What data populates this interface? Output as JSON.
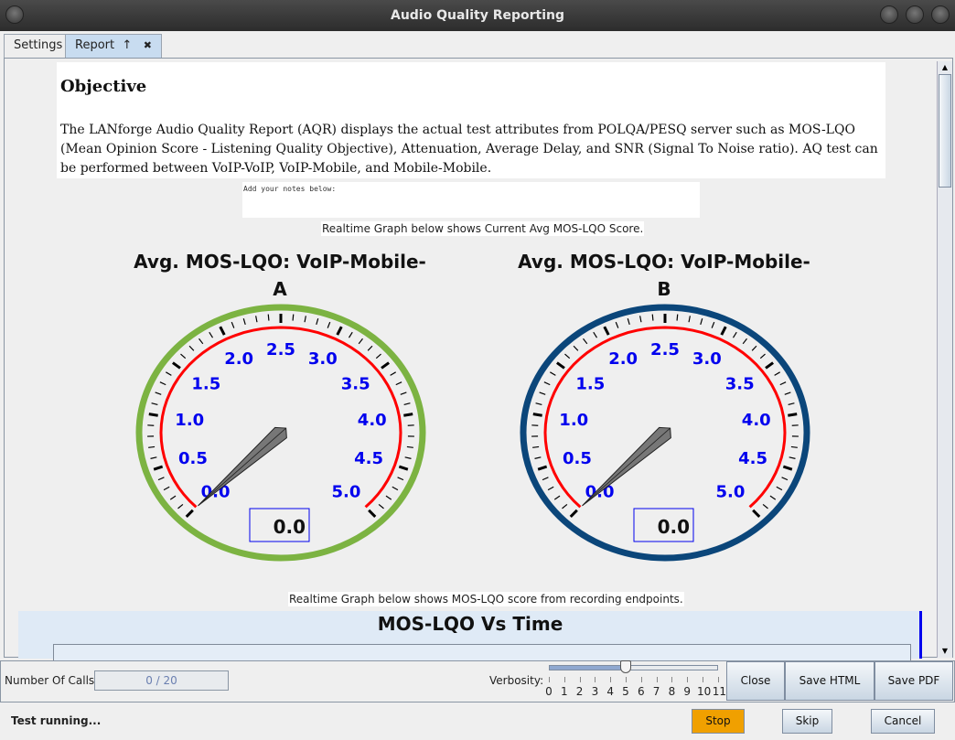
{
  "window": {
    "title": "Audio Quality Reporting"
  },
  "tabs": [
    {
      "label": "Settings"
    },
    {
      "label": "Report",
      "pin": "↑",
      "close": "✖"
    }
  ],
  "objective": {
    "heading": "Objective",
    "text": "The LANforge Audio Quality Report (AQR) displays the actual test attributes from POLQA/PESQ server such as MOS-LQO (Mean Opinion Score - Listening Quality Objective), Attenuation, Average Delay, and SNR (Signal To Noise ratio). AQ test can be performed between VoIP-VoIP, VoIP-Mobile, and Mobile-Mobile."
  },
  "notes": {
    "placeholder": "Add your notes below:"
  },
  "caption1": "Realtime Graph below shows Current Avg MOS-LQO Score.",
  "gauges": [
    {
      "title1": "Avg. MOS-LQO: VoIP-Mobile-",
      "title2": "A",
      "value": 0.0,
      "display": "0.0",
      "ring_color": "#7cb342"
    },
    {
      "title1": "Avg. MOS-LQO: VoIP-Mobile-",
      "title2": "B",
      "value": 0.0,
      "display": "0.0",
      "ring_color": "#0b467a"
    }
  ],
  "gauge_scale": {
    "min": 0,
    "max": 5,
    "labels": [
      "0.0",
      "0.5",
      "1.0",
      "1.5",
      "2.0",
      "2.5",
      "3.0",
      "3.5",
      "4.0",
      "4.5",
      "5.0"
    ],
    "label_color": "#0000ee",
    "arc_color": "#ff0000"
  },
  "caption2": "Realtime Graph below shows MOS-LQO score from recording endpoints.",
  "chart": {
    "title": "MOS-LQO Vs Time"
  },
  "footer": {
    "calls_label": "Number Of Calls:",
    "calls_value": "0 / 20",
    "verbosity_label": "Verbosity:",
    "verbosity_value": 5,
    "verbosity_ticks": [
      "0",
      "1",
      "2",
      "3",
      "4",
      "5",
      "6",
      "7",
      "8",
      "9",
      "10",
      "11"
    ],
    "close": "Close",
    "save_html": "Save HTML",
    "save_pdf": "Save PDF"
  },
  "status": {
    "text": "Test running...",
    "stop": "Stop",
    "skip": "Skip",
    "cancel": "Cancel",
    "stop_color": "#f0a000"
  }
}
